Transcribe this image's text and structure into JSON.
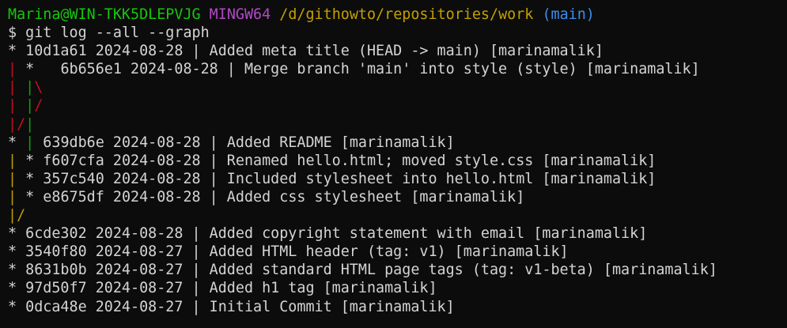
{
  "prompt": {
    "user_host": "Marina@WIN-TKK5DLEPVJG",
    "shell": "MINGW64",
    "path": "/d/githowto/repositories/work",
    "branch": "(main)"
  },
  "command": {
    "symbol": "$",
    "text": "git log --all --graph"
  },
  "log": {
    "l1": "* 10d1a61 2024-08-28 | Added meta title (HEAD -> main) [marinamalik]",
    "l2a": "|",
    "l2b": " *   6b656e1 2024-08-28 | Merge branch 'main' into style (style) [marinamalik]",
    "l3a": "|",
    "l3b": " |",
    "l3c": "\\",
    "l4a": "|",
    "l4b": " |",
    "l4c": "/",
    "l5a": "|/",
    "l5b": "|",
    "l6a": "* ",
    "l6b": "|",
    "l6c": " 639db6e 2024-08-28 | Added README [marinamalik]",
    "l7a": "|",
    "l7b": " * f607cfa 2024-08-28 | Renamed hello.html; moved style.css [marinamalik]",
    "l8a": "|",
    "l8b": " * 357c540 2024-08-28 | Included stylesheet into hello.html [marinamalik]",
    "l9a": "|",
    "l9b": " * e8675df 2024-08-28 | Added css stylesheet [marinamalik]",
    "l10": "|/",
    "l11": "* 6cde302 2024-08-28 | Added copyright statement with email [marinamalik]",
    "l12": "* 3540f80 2024-08-27 | Added HTML header (tag: v1) [marinamalik]",
    "l13": "* 8631b0b 2024-08-27 | Added standard HTML page tags (tag: v1-beta) [marinamalik]",
    "l14": "* 97d50f7 2024-08-27 | Added h1 tag [marinamalik]",
    "l15": "* 0dca48e 2024-08-27 | Initial Commit [marinamalik]"
  },
  "colors": {
    "background": "#0c0c0c",
    "text": "#d4d4d4",
    "user_host": "#16c60c",
    "shell": "#b148c6",
    "path": "#c4a000",
    "branch": "#3b8eea",
    "graph_red": "#c50f1f",
    "graph_green": "#13a10e",
    "graph_yellow": "#c19c00"
  }
}
